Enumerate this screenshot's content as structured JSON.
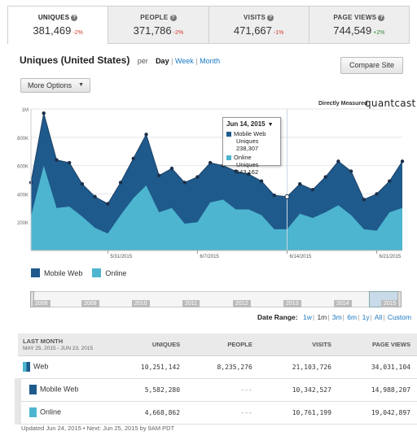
{
  "tabs": [
    {
      "label": "UNIQUES",
      "value": "381,469",
      "change": "-2%",
      "dir": "neg",
      "active": true
    },
    {
      "label": "PEOPLE",
      "value": "371,786",
      "change": "-2%",
      "dir": "neg",
      "active": false
    },
    {
      "label": "VISITS",
      "value": "471,667",
      "change": "-1%",
      "dir": "neg",
      "active": false
    },
    {
      "label": "PAGE VIEWS",
      "value": "744,549",
      "change": "+2%",
      "dir": "pos",
      "active": false
    }
  ],
  "header": {
    "title": "Uniques (United States)",
    "per": "per",
    "period_day": "Day",
    "period_week": "Week",
    "period_month": "Month",
    "compare_label": "Compare Site",
    "more_options_label": "More Options"
  },
  "brand": {
    "directly_measured": "Directly Measured",
    "logo_text": "quantcast"
  },
  "colors": {
    "mobile_web": "#1f5a8c",
    "online": "#4db5cf",
    "accent_link": "#1a78c2",
    "negative": "#d0392b",
    "positive": "#2e8b2e"
  },
  "chart_data": {
    "type": "area",
    "yticks": [
      "1M",
      "800K",
      "600K",
      "400K",
      "200K"
    ],
    "ylim": [
      0,
      1000000
    ],
    "xtick_labels": [
      "5/31/2015",
      "6/7/2015",
      "6/14/2015",
      "6/21/2015"
    ],
    "xtick_index": [
      6,
      13,
      20,
      27
    ],
    "series": [
      {
        "name": "Mobile Web",
        "total": [
          480000,
          970000,
          640000,
          620000,
          470000,
          380000,
          330000,
          480000,
          650000,
          820000,
          530000,
          580000,
          480000,
          520000,
          620000,
          600000,
          560000,
          540000,
          490000,
          390000,
          380000,
          470000,
          430000,
          520000,
          630000,
          560000,
          360000,
          400000,
          490000,
          630000
        ]
      },
      {
        "name": "Online",
        "values": [
          240000,
          600000,
          300000,
          310000,
          240000,
          160000,
          120000,
          250000,
          370000,
          460000,
          270000,
          300000,
          190000,
          200000,
          340000,
          360000,
          290000,
          290000,
          250000,
          150000,
          150000,
          260000,
          230000,
          270000,
          320000,
          250000,
          150000,
          140000,
          270000,
          300000
        ]
      }
    ],
    "tooltip": {
      "date": "Jun 14, 2015",
      "mobile_label": "Mobile Web",
      "mobile_value": "Uniques  238,307",
      "online_label": "Online",
      "online_value": "Uniques  143,162"
    }
  },
  "legend": {
    "mobile": "Mobile Web",
    "online": "Online"
  },
  "range": {
    "years": [
      "2008",
      "2009",
      "2010",
      "2011",
      "2012",
      "2013",
      "2014",
      "2015"
    ],
    "label": "Date Range:",
    "options": [
      "1w",
      "1m",
      "3m",
      "6m",
      "1y",
      "All",
      "Custom"
    ]
  },
  "table": {
    "head_period": "LAST MONTH",
    "head_dates": "MAY 25, 2015 - JUN 23, 2015",
    "columns": [
      "UNIQUES",
      "PEOPLE",
      "VISITS",
      "PAGE VIEWS"
    ],
    "rows": [
      {
        "name": "Web",
        "uniques": "10,251,142",
        "people": "8,235,276",
        "visits": "21,103,726",
        "pageviews": "34,031,104"
      },
      {
        "name": "Mobile Web",
        "uniques": "5,582,280",
        "people": "---",
        "visits": "10,342,527",
        "pageviews": "14,988,207"
      },
      {
        "name": "Online",
        "uniques": "4,668,862",
        "people": "---",
        "visits": "10,761,199",
        "pageviews": "19,042,897"
      }
    ]
  },
  "footnote": "Updated Jun 24, 2015 • Next: Jun 25, 2015 by 9AM PDT"
}
